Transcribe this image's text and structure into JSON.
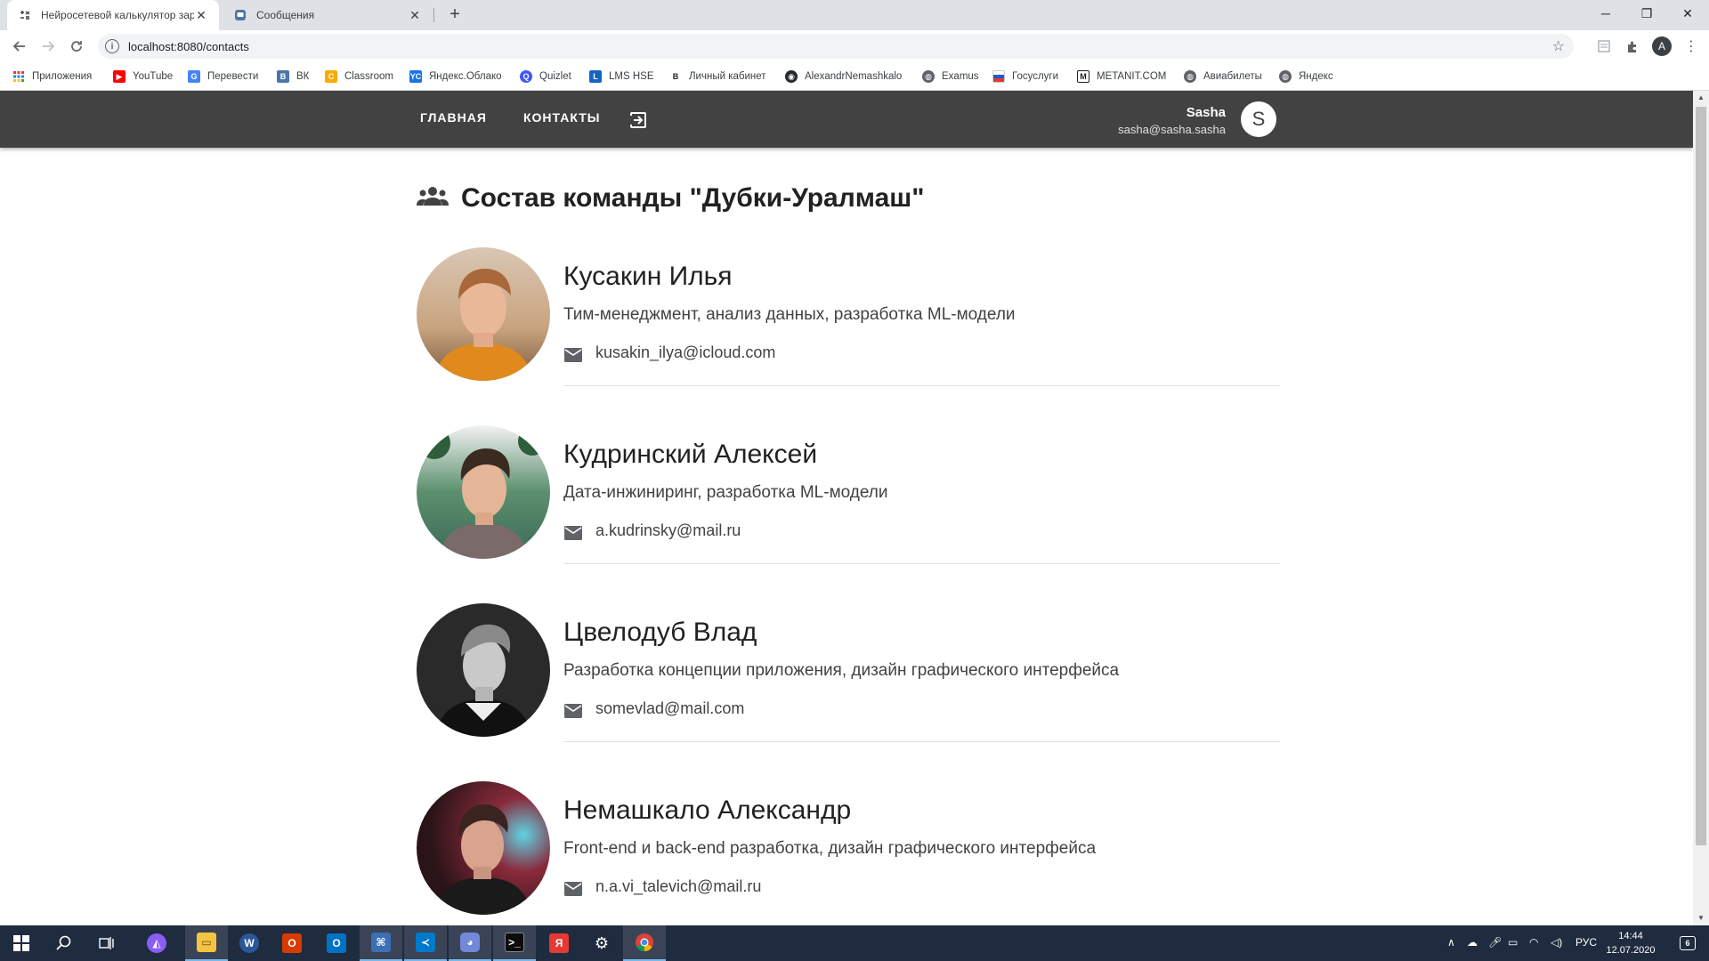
{
  "browser": {
    "tabs": [
      {
        "title": "Нейросетевой калькулятор зар",
        "active": true
      },
      {
        "title": "Сообщения",
        "active": false
      }
    ],
    "url": "localhost:8080/contacts",
    "profile_initial": "A",
    "bookmarks": [
      {
        "label": "Приложения",
        "icon": "apps-grid-icon"
      },
      {
        "label": "YouTube",
        "icon": "youtube-icon"
      },
      {
        "label": "Перевести",
        "icon": "translate-icon"
      },
      {
        "label": "ВК",
        "icon": "vk-icon"
      },
      {
        "label": "Classroom",
        "icon": "classroom-icon"
      },
      {
        "label": "Яндекс.Облако",
        "icon": "yandex-cloud-icon"
      },
      {
        "label": "Quizlet",
        "icon": "quizlet-icon"
      },
      {
        "label": "LMS HSE",
        "icon": "lms-icon"
      },
      {
        "label": "Личный кабинет",
        "icon": "cabinet-icon"
      },
      {
        "label": "AlexandrNemashkalo",
        "icon": "github-icon"
      },
      {
        "label": "Examus",
        "icon": "globe-icon"
      },
      {
        "label": "Госуслуги",
        "icon": "gosuslugi-icon"
      },
      {
        "label": "METANIT.COM",
        "icon": "metanit-icon"
      },
      {
        "label": "Авиабилеты",
        "icon": "globe-icon"
      },
      {
        "label": "Яндекс",
        "icon": "globe-icon"
      }
    ]
  },
  "appbar": {
    "nav": [
      "ГЛАВНАЯ",
      "КОНТАКТЫ"
    ],
    "user_name": "Sasha",
    "user_email": "sasha@sasha.sasha",
    "avatar_initial": "S"
  },
  "page": {
    "title": "Состав команды \"Дубки-Уралмаш\"",
    "members": [
      {
        "name": "Кусакин Илья",
        "role": "Тим-менеджмент, анализ данных, разработка ML-модели",
        "email": "kusakin_ilya@icloud.com"
      },
      {
        "name": "Кудринский Алексей",
        "role": "Дата-инжиниринг, разработка ML-модели",
        "email": "a.kudrinsky@mail.ru"
      },
      {
        "name": "Цвелодуб Влад",
        "role": "Разработка концепции приложения, дизайн графического интерфейса",
        "email": "somevlad@mail.com"
      },
      {
        "name": "Немашкало Александр",
        "role": "Front-end и back-end разработка, дизайн графического интерфейса",
        "email": "n.a.vi_talevich@mail.ru"
      }
    ]
  },
  "taskbar": {
    "language": "РУС",
    "time": "14:44",
    "date": "12.07.2020",
    "notifications": "6"
  },
  "colors": {
    "appbar": "#424242",
    "taskbar": "#1f2b3f",
    "tabstrip": "#dee1e6"
  }
}
